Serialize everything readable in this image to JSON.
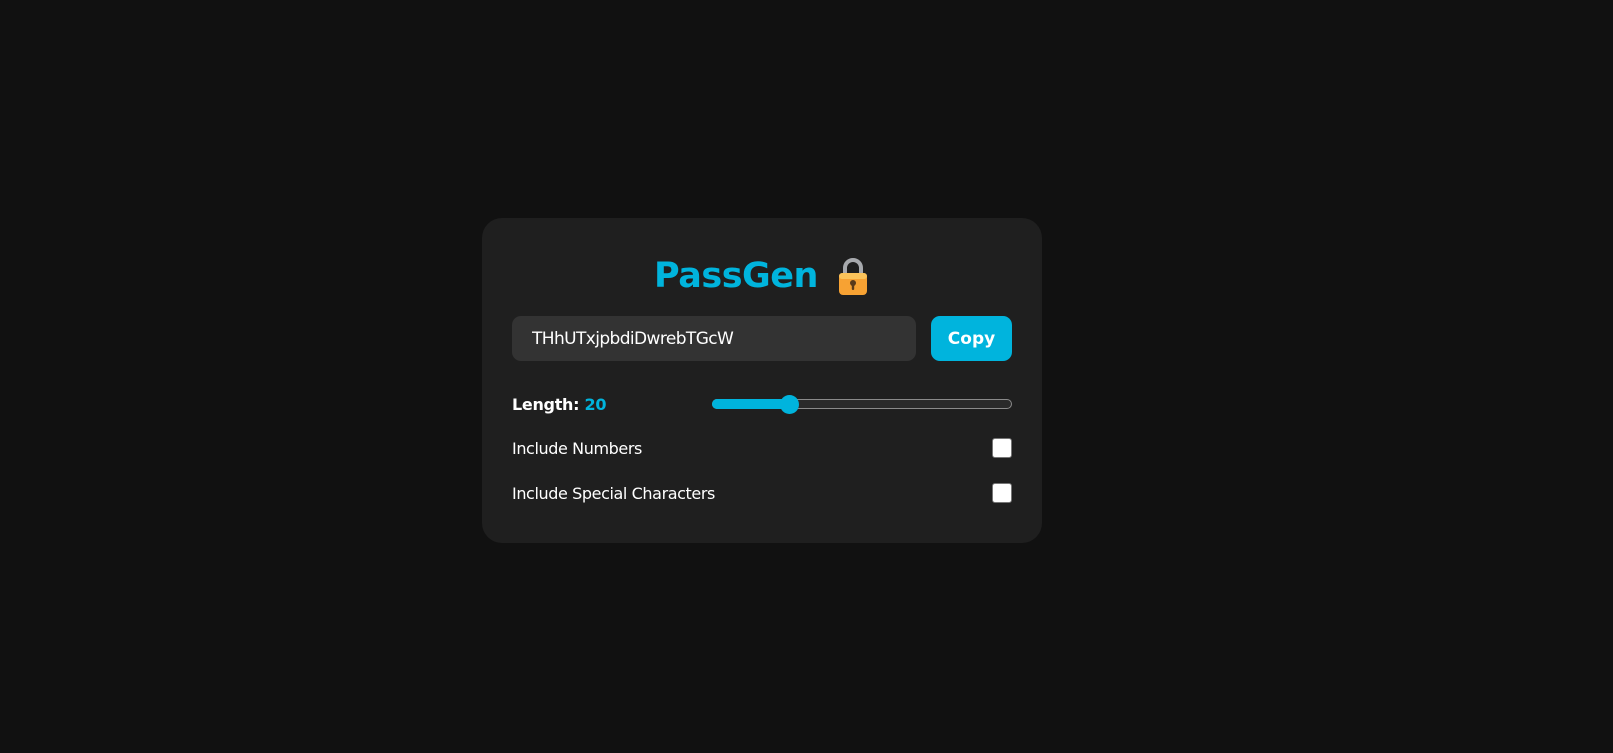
{
  "app": {
    "title": "PassGen",
    "title_icon": "lock-icon"
  },
  "password": {
    "value": "THhUTxjpbdiDwrebTGcW",
    "copy_label": "Copy"
  },
  "length": {
    "label": "Length:",
    "value": "20",
    "slider_fraction": 0.256
  },
  "options": [
    {
      "label": "Include Numbers",
      "checked": false
    },
    {
      "label": "Include Special Characters",
      "checked": false
    }
  ],
  "colors": {
    "accent": "#00b4dd",
    "background": "#111111",
    "card": "#1f1f1f",
    "field": "#333333"
  }
}
